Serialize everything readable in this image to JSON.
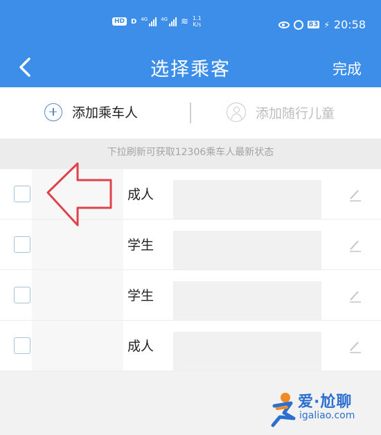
{
  "status_bar": {
    "hd_label": "HD",
    "hd_sub": "D",
    "sig1_tag": "4G",
    "sig2_tag": "4G",
    "net_speed_value": "1.1",
    "net_speed_unit": "K/s",
    "battery": "83",
    "time": "20:58"
  },
  "nav": {
    "title": "选择乘客",
    "done_label": "完成"
  },
  "add_row": {
    "add_adult_label": "添加乘车人",
    "add_child_label": "添加随行儿童"
  },
  "hint": "下拉刷新可获取12306乘车人最新状态",
  "passengers": [
    {
      "type": "成人"
    },
    {
      "type": "学生"
    },
    {
      "type": "学生"
    },
    {
      "type": "成人"
    }
  ],
  "watermark": {
    "title": "爱·尬聊",
    "domain": "igaliao.com"
  },
  "colors": {
    "primary": "#3d8ee8",
    "annotation_arrow": "#e0424a",
    "watermark": "#2b6fd1"
  }
}
